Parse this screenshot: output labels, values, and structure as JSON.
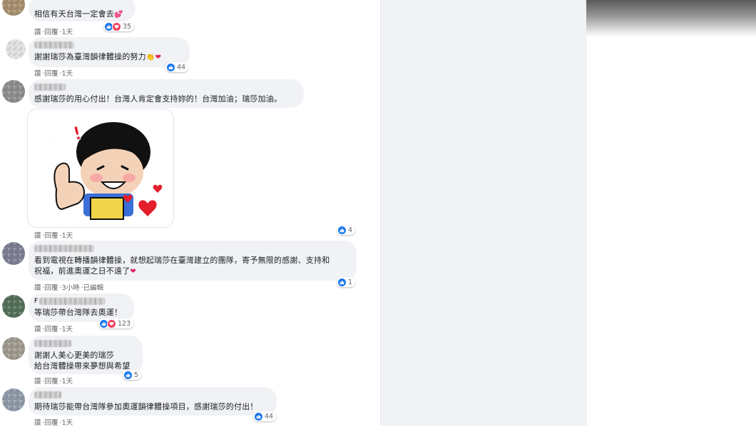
{
  "comments": [
    {
      "text": "相信有天台灣一定會去",
      "actions": [
        "讚",
        "回覆",
        "1天"
      ],
      "reaction_count": "35",
      "reaction_types": [
        "like-icon",
        "love-icon"
      ]
    },
    {
      "text": "謝謝瑞莎為臺灣韻律體操的努力",
      "actions": [
        "讚",
        "回覆",
        "1天"
      ],
      "reaction_count": "44",
      "reaction_types": [
        "like-icon"
      ]
    },
    {
      "text": "感謝瑞莎的用心付出！台灣人肯定會支持妳的！台灣加油；瑞莎加油。",
      "actions": [
        "讚",
        "回覆",
        "1天"
      ],
      "reaction_count": "4",
      "reaction_types": [
        "like-icon"
      ],
      "sticker_text": "超讚!"
    },
    {
      "text": "看到電視在轉播韻律體操，就想起瑞莎在臺灣建立的團隊，寄予無限的感謝、支持和\n祝福，前進奧運之日不遠了",
      "actions": [
        "讚",
        "回覆",
        "3小時",
        "已編輯"
      ],
      "reaction_count": "1",
      "reaction_types": [
        "like-icon"
      ]
    },
    {
      "text": "等瑞莎帶台灣隊去奧運！",
      "actions": [
        "讚",
        "回覆",
        "1天"
      ],
      "reaction_count": "123",
      "reaction_types": [
        "like-icon",
        "love-icon"
      ],
      "name_initial": "F"
    },
    {
      "text": "謝謝人美心更美的瑞莎\n給台灣體操帶來夢想與希望",
      "actions": [
        "讚",
        "回覆",
        "1天"
      ],
      "reaction_count": "5",
      "reaction_types": [
        "like-icon"
      ]
    },
    {
      "text": "期待瑞莎能帶台灣隊參加奧運韻律體操項目，感謝瑞莎的付出！",
      "actions": [
        "讚",
        "回覆",
        "1天"
      ],
      "reaction_count": "44",
      "reaction_types": [
        "like-icon"
      ]
    }
  ],
  "colors": {
    "like": "#1877f2",
    "love": "#f33e58",
    "bubble": "#f0f2f5",
    "meta_text": "#65676b"
  }
}
